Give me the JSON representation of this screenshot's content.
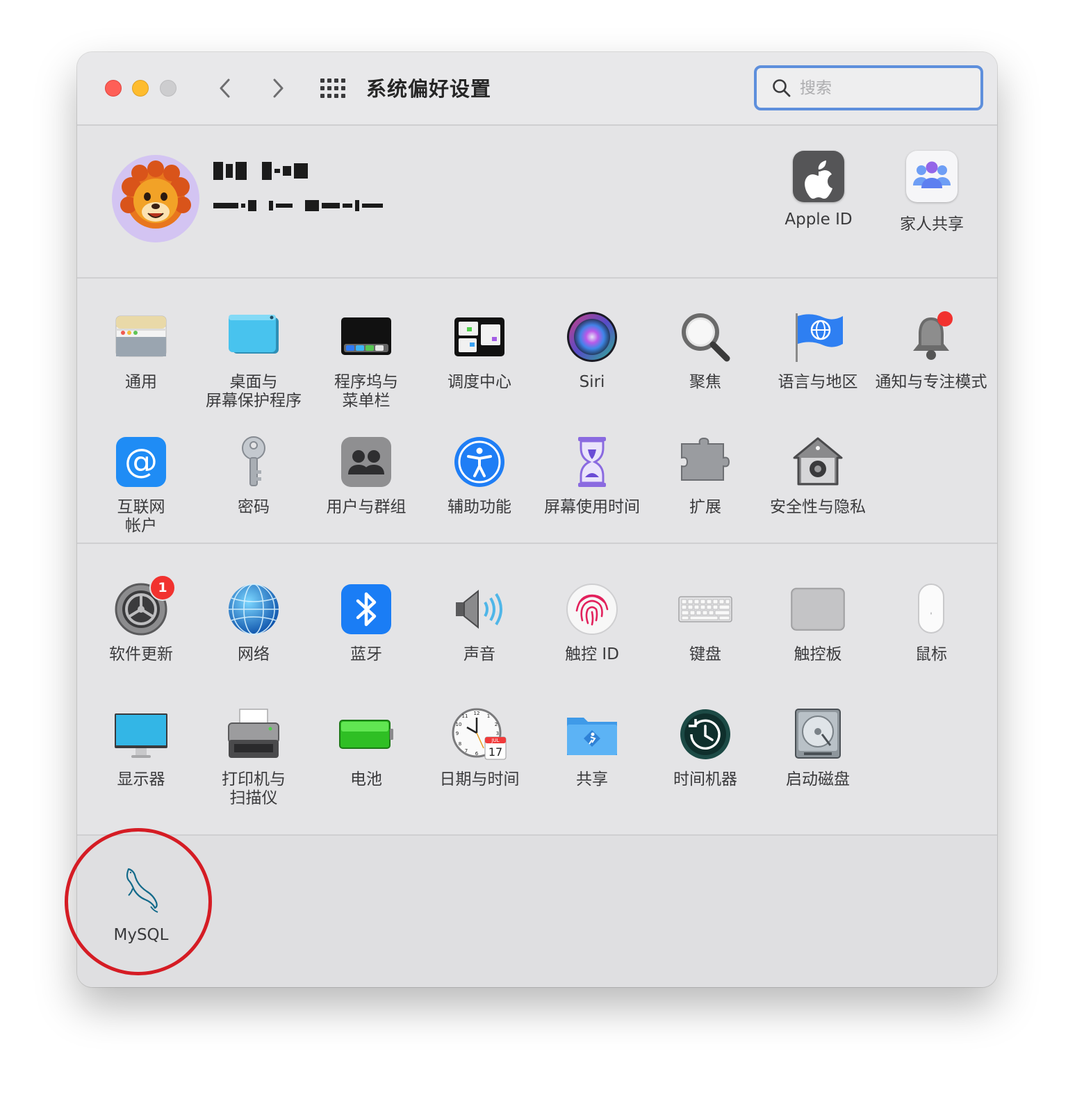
{
  "window": {
    "title": "系统偏好设置",
    "search_placeholder": "搜索"
  },
  "account": {
    "name_obscured": "YW C.m",
    "email_obscured": "w.E :... d*.l..",
    "items": [
      {
        "label": "Apple ID",
        "icon": "apple-logo-icon"
      },
      {
        "label": "家人共享",
        "icon": "family-sharing-icon"
      }
    ]
  },
  "section1": [
    {
      "label": "通用",
      "icon": "general-icon"
    },
    {
      "label": "桌面与\n屏幕保护程序",
      "icon": "desktop-screensaver-icon"
    },
    {
      "label": "程序坞与\n菜单栏",
      "icon": "dock-menubar-icon"
    },
    {
      "label": "调度中心",
      "icon": "mission-control-icon"
    },
    {
      "label": "Siri",
      "icon": "siri-icon"
    },
    {
      "label": "聚焦",
      "icon": "spotlight-icon"
    },
    {
      "label": "语言与地区",
      "icon": "language-region-icon"
    },
    {
      "label": "通知与专注模式",
      "icon": "notifications-icon"
    },
    {
      "label": "互联网\n帐户",
      "icon": "internet-accounts-icon"
    },
    {
      "label": "密码",
      "icon": "passwords-icon"
    },
    {
      "label": "用户与群组",
      "icon": "users-groups-icon"
    },
    {
      "label": "辅助功能",
      "icon": "accessibility-icon"
    },
    {
      "label": "屏幕使用时间",
      "icon": "screen-time-icon"
    },
    {
      "label": "扩展",
      "icon": "extensions-icon"
    },
    {
      "label": "安全性与隐私",
      "icon": "security-privacy-icon"
    }
  ],
  "section2": [
    {
      "label": "软件更新",
      "icon": "software-update-icon",
      "badge": "1"
    },
    {
      "label": "网络",
      "icon": "network-icon"
    },
    {
      "label": "蓝牙",
      "icon": "bluetooth-icon"
    },
    {
      "label": "声音",
      "icon": "sound-icon"
    },
    {
      "label": "触控 ID",
      "icon": "touch-id-icon"
    },
    {
      "label": "键盘",
      "icon": "keyboard-icon"
    },
    {
      "label": "触控板",
      "icon": "trackpad-icon"
    },
    {
      "label": "鼠标",
      "icon": "mouse-icon"
    },
    {
      "label": "显示器",
      "icon": "displays-icon"
    },
    {
      "label": "打印机与\n扫描仪",
      "icon": "printers-scanners-icon"
    },
    {
      "label": "电池",
      "icon": "battery-icon"
    },
    {
      "label": "日期与时间",
      "icon": "date-time-icon",
      "calendar_month": "JUL",
      "calendar_day": "17"
    },
    {
      "label": "共享",
      "icon": "sharing-icon"
    },
    {
      "label": "时间机器",
      "icon": "time-machine-icon"
    },
    {
      "label": "启动磁盘",
      "icon": "startup-disk-icon"
    }
  ],
  "section3": [
    {
      "label": "MySQL",
      "icon": "mysql-dolphin-icon"
    }
  ],
  "colors": {
    "window_bg": "#e4e4e6",
    "search_focus_ring": "#5e8fdc",
    "badge_red": "#f1322f",
    "annotation_circle": "#d51c24"
  }
}
